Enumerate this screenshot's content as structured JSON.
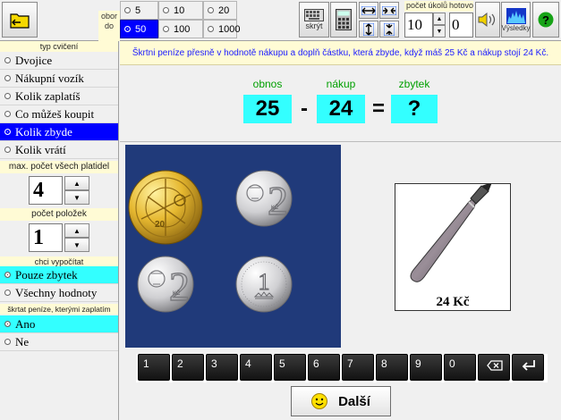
{
  "toolbar": {
    "obor_label_1": "obor",
    "obor_label_2": "do",
    "range_options": [
      {
        "label": "5",
        "selected": false
      },
      {
        "label": "10",
        "selected": false
      },
      {
        "label": "20",
        "selected": false
      },
      {
        "label": "50",
        "selected": true
      },
      {
        "label": "100",
        "selected": false
      },
      {
        "label": "1000",
        "selected": false
      }
    ],
    "hide_label": "skrýt",
    "pocet_ukolu_label": "počet úkolů",
    "pocet_ukolu_value": "10",
    "hotovo_label": "hotovo",
    "hotovo_value": "0",
    "results_label": "Výsledky"
  },
  "left": {
    "type_title": "typ cvičení",
    "types": [
      {
        "label": "Dvojice",
        "selected": false
      },
      {
        "label": "Nákupní vozík",
        "selected": false
      },
      {
        "label": "Kolik zaplatíš",
        "selected": false
      },
      {
        "label": "Co můžeš koupit",
        "selected": false
      },
      {
        "label": "Kolik zbyde",
        "selected": true
      },
      {
        "label": "Kolik vrátí",
        "selected": false
      }
    ],
    "max_title": "max. počet všech platidel",
    "max_value": "4",
    "items_title": "počet položek",
    "items_value": "1",
    "calc_title": "chci vypočítat",
    "calc_options": [
      {
        "label": "Pouze zbytek",
        "selected": true
      },
      {
        "label": "Všechny hodnoty",
        "selected": false
      }
    ],
    "strike_title": "škrtat peníze, kterými zaplatím",
    "strike_options": [
      {
        "label": "Ano",
        "selected": true
      },
      {
        "label": "Ne",
        "selected": false
      }
    ]
  },
  "instruction": "Škrtni peníze přesně v hodnotě nákupu a doplň částku, která zbyde, když máš 25 Kč a nákup stojí 24 Kč.",
  "equation": {
    "obnos_label": "obnos",
    "nakup_label": "nákup",
    "zbytek_label": "zbytek",
    "obnos": "25",
    "minus": "-",
    "nakup": "24",
    "equals": "=",
    "zbytek": "?"
  },
  "coins": [
    {
      "value": "20",
      "name": "coin-20-kc"
    },
    {
      "value": "2",
      "name": "coin-2-kc"
    },
    {
      "value": "2",
      "name": "coin-2-kc"
    },
    {
      "value": "1",
      "name": "coin-1-kc"
    }
  ],
  "item": {
    "price": "24 Kč",
    "icon": "brush-icon"
  },
  "keypad": {
    "keys": [
      "1",
      "2",
      "3",
      "4",
      "5",
      "6",
      "7",
      "8",
      "9",
      "0"
    ]
  },
  "next_label": "Další",
  "colors": {
    "blue_sel": "#0000ff",
    "cyan": "#33ffff",
    "green_label": "#00a000",
    "instr_text": "#1c1cff",
    "coin_bg": "#203a7a"
  }
}
